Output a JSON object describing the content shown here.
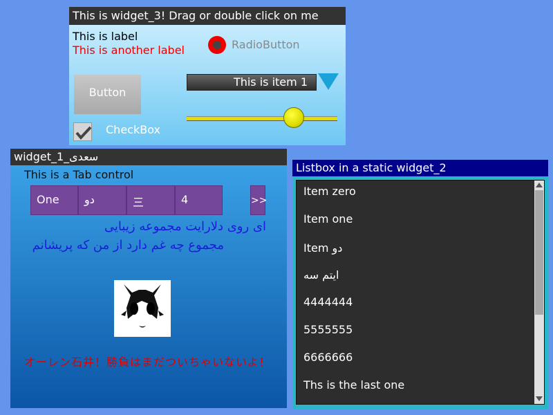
{
  "widget3": {
    "title": "This is widget_3! Drag or double click on me",
    "label1": "This is label",
    "label2": "This is another label",
    "radio_label": "RadioButton",
    "button_label": "Button",
    "combo_value": "This is item 1",
    "checkbox_label": "CheckBox",
    "checkbox_checked": true,
    "slider_value": 0.71
  },
  "widget1": {
    "title": "سعدی_widget_1",
    "tab_title": "This is a Tab control",
    "tabs": [
      "One",
      "دو",
      "三",
      "4"
    ],
    "tab_more": ">>",
    "persian_line1": "ای روی دلارایت مجموعه زیبایی",
    "persian_line2": "مجموع چه غم دارد از من که پریشانم",
    "japanese_text": "オーレン石井！勝負はまだついちゃいないよ！"
  },
  "widget2": {
    "title": "Listbox in a static widget_2",
    "items": [
      "Item zero",
      "Item one",
      "Item دو",
      "ایتم سه",
      "4444444",
      "5555555",
      "6666666",
      "Ths is the last one"
    ]
  },
  "colors": {
    "background": "#6495ed",
    "tab_purple": "#74479a",
    "persian_text": "#1b1bdc",
    "japanese_text": "#e00000"
  }
}
